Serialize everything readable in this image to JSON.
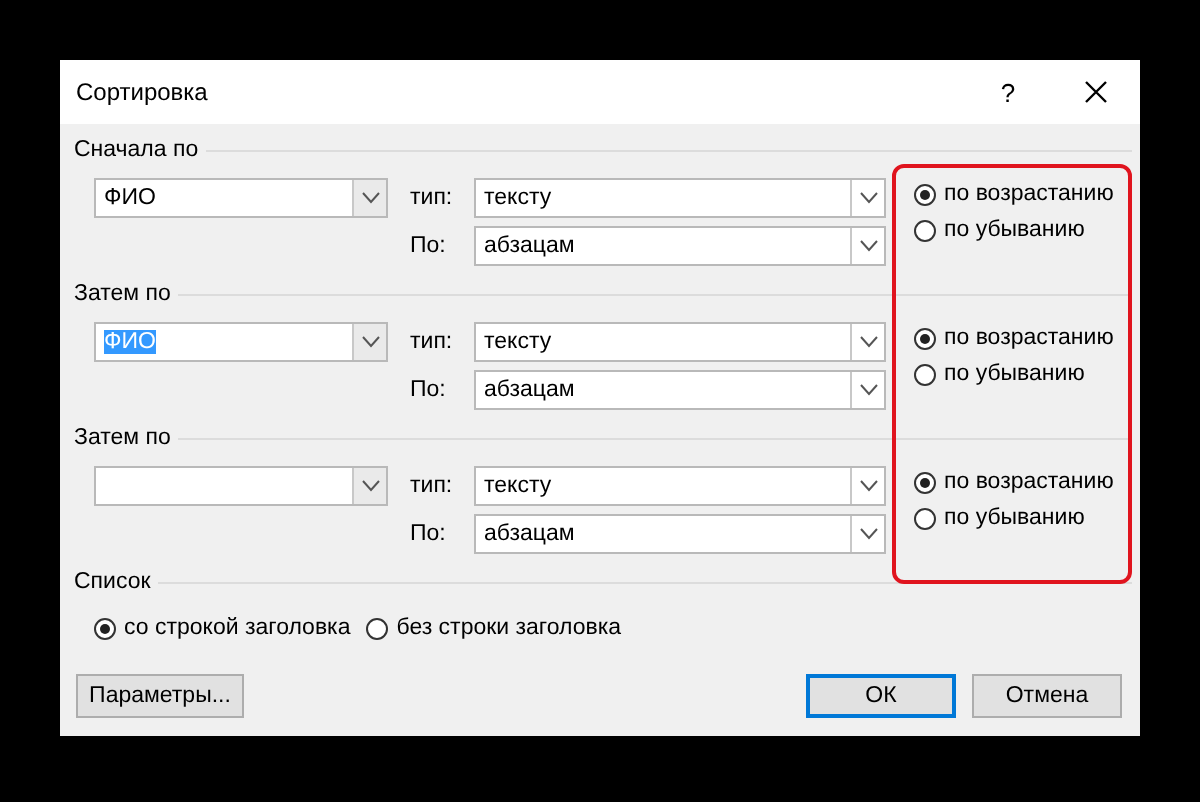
{
  "window": {
    "title": "Сортировка",
    "help": "?"
  },
  "sort_levels": [
    {
      "heading": "Сначала по",
      "field": {
        "value": "ФИО",
        "highlighted": false
      },
      "type_label": "тип:",
      "type_value": "тексту",
      "by_label": "По:",
      "by_value": "абзацам",
      "orders": [
        {
          "label": "по возрастанию",
          "selected": true
        },
        {
          "label": "по убыванию",
          "selected": false
        }
      ]
    },
    {
      "heading": "Затем по",
      "field": {
        "value": "ФИО",
        "highlighted": true
      },
      "type_label": "тип:",
      "type_value": "тексту",
      "by_label": "По:",
      "by_value": "абзацам",
      "orders": [
        {
          "label": "по возрастанию",
          "selected": true
        },
        {
          "label": "по убыванию",
          "selected": false
        }
      ]
    },
    {
      "heading": "Затем по",
      "type_label": "тип:",
      "type_value": "тексту",
      "by_label": "По:",
      "by_value": "абзацам",
      "orders": [
        {
          "label": "по возрастанию",
          "selected": true
        },
        {
          "label": "по убыванию",
          "selected": false
        }
      ]
    }
  ],
  "list": {
    "heading": "Список",
    "options": [
      {
        "label": "со строкой заголовка",
        "selected": true
      },
      {
        "label": "без строки заголовка",
        "selected": false
      }
    ]
  },
  "buttons": [
    {
      "label": "Параметры...",
      "default": false
    },
    {
      "label": "ОК",
      "default": true
    },
    {
      "label": "Отмена",
      "default": false
    }
  ]
}
